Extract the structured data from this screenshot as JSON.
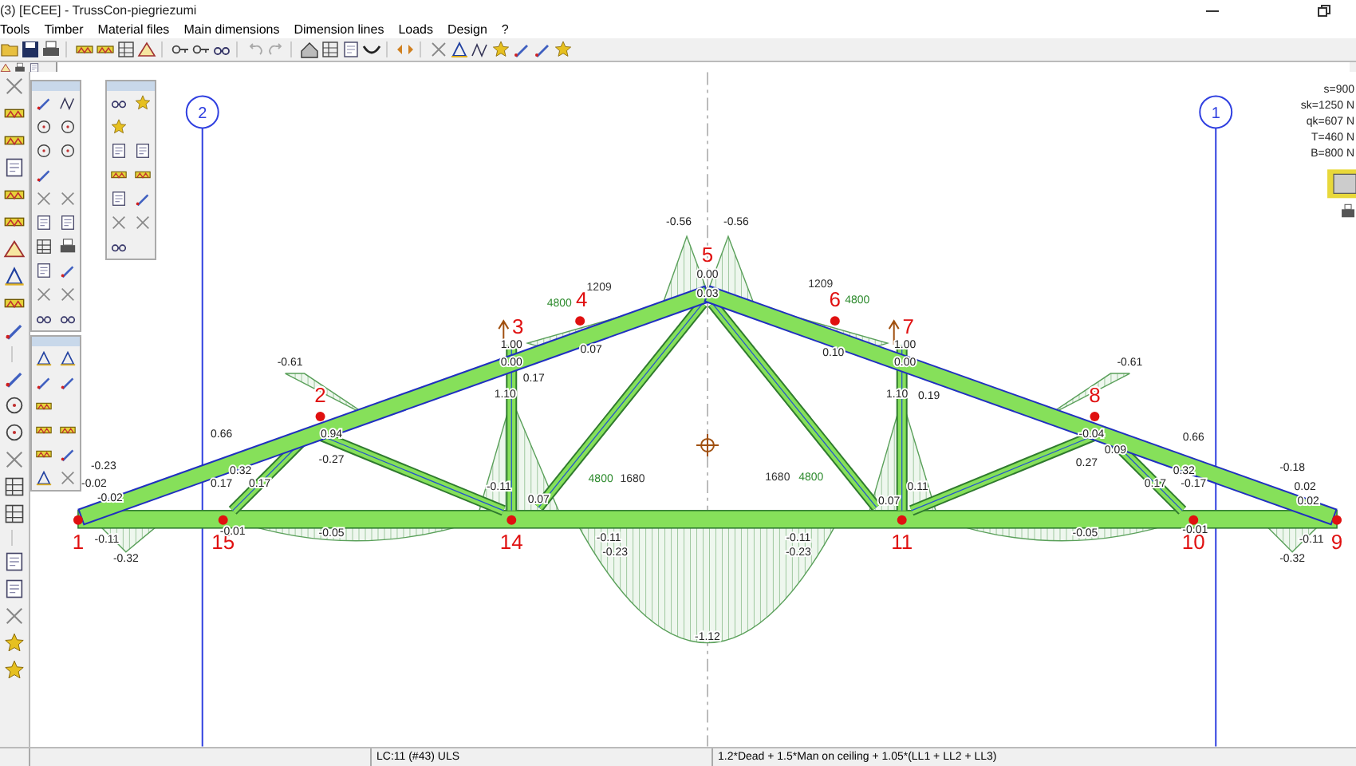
{
  "window": {
    "title": "(3) [ECEE] - TrussCon-piegriezumi"
  },
  "menu": [
    "Tools",
    "Timber",
    "Material files",
    "Main dimensions",
    "Dimension lines",
    "Loads",
    "Design",
    "?"
  ],
  "grid_axes": [
    {
      "label": "2"
    },
    {
      "label": "1"
    }
  ],
  "legend": [
    "s=900",
    "sk=1250 N",
    "qk=607 N",
    "T=460 N",
    "B=800 N"
  ],
  "nodes": [
    {
      "label": "1"
    },
    {
      "label": "15"
    },
    {
      "label": "2"
    },
    {
      "label": "14"
    },
    {
      "label": "3"
    },
    {
      "label": "4"
    },
    {
      "label": "5"
    },
    {
      "label": "6"
    },
    {
      "label": "11"
    },
    {
      "label": "7"
    },
    {
      "label": "8"
    },
    {
      "label": "10"
    },
    {
      "label": "9"
    }
  ],
  "values": [
    {
      "text": "-0.23",
      "kind": "moment"
    },
    {
      "text": "-0.02",
      "kind": "moment"
    },
    {
      "text": "-0.02",
      "kind": "moment"
    },
    {
      "text": "-0.11",
      "kind": "moment"
    },
    {
      "text": "-0.32",
      "kind": "moment"
    },
    {
      "text": "0.66",
      "kind": "moment"
    },
    {
      "text": "0.32",
      "kind": "moment"
    },
    {
      "text": "0.17",
      "kind": "moment"
    },
    {
      "text": "0.17",
      "kind": "moment"
    },
    {
      "text": "-0.01",
      "kind": "moment"
    },
    {
      "text": "-0.05",
      "kind": "moment"
    },
    {
      "text": "-0.61",
      "kind": "moment"
    },
    {
      "text": "0.94",
      "kind": "moment"
    },
    {
      "text": "-0.27",
      "kind": "moment"
    },
    {
      "text": "1.00",
      "kind": "moment"
    },
    {
      "text": "0.00",
      "kind": "moment"
    },
    {
      "text": "0.17",
      "kind": "moment"
    },
    {
      "text": "1.10",
      "kind": "moment"
    },
    {
      "text": "-0.11",
      "kind": "moment"
    },
    {
      "text": "0.07",
      "kind": "moment"
    },
    {
      "text": "0.07",
      "kind": "moment"
    },
    {
      "text": "4800",
      "kind": "dimension"
    },
    {
      "text": "1209",
      "kind": "position"
    },
    {
      "text": "4800",
      "kind": "dimension"
    },
    {
      "text": "1680",
      "kind": "position"
    },
    {
      "text": "-0.11",
      "kind": "moment"
    },
    {
      "text": "-0.23",
      "kind": "moment"
    },
    {
      "text": "-0.56",
      "kind": "moment"
    },
    {
      "text": "-0.56",
      "kind": "moment"
    },
    {
      "text": "0.00",
      "kind": "moment"
    },
    {
      "text": "0.03",
      "kind": "moment"
    },
    {
      "text": "-1.12",
      "kind": "moment"
    },
    {
      "text": "1209",
      "kind": "position"
    },
    {
      "text": "4800",
      "kind": "dimension"
    },
    {
      "text": "0.10",
      "kind": "moment"
    },
    {
      "text": "1.00",
      "kind": "moment"
    },
    {
      "text": "0.00",
      "kind": "moment"
    },
    {
      "text": "1.10",
      "kind": "moment"
    },
    {
      "text": "0.19",
      "kind": "moment"
    },
    {
      "text": "1680",
      "kind": "position"
    },
    {
      "text": "4800",
      "kind": "dimension"
    },
    {
      "text": "0.11",
      "kind": "moment"
    },
    {
      "text": "0.07",
      "kind": "moment"
    },
    {
      "text": "-0.11",
      "kind": "moment"
    },
    {
      "text": "-0.23",
      "kind": "moment"
    },
    {
      "text": "-0.61",
      "kind": "moment"
    },
    {
      "text": "-0.04",
      "kind": "moment"
    },
    {
      "text": "0.09",
      "kind": "moment"
    },
    {
      "text": "0.27",
      "kind": "moment"
    },
    {
      "text": "0.66",
      "kind": "moment"
    },
    {
      "text": "0.32",
      "kind": "moment"
    },
    {
      "text": "0.17",
      "kind": "moment"
    },
    {
      "text": "-0.17",
      "kind": "moment"
    },
    {
      "text": "-0.05",
      "kind": "moment"
    },
    {
      "text": "-0.01",
      "kind": "moment"
    },
    {
      "text": "-0.18",
      "kind": "moment"
    },
    {
      "text": "0.02",
      "kind": "moment"
    },
    {
      "text": "0.02",
      "kind": "moment"
    },
    {
      "text": "-0.11",
      "kind": "moment"
    },
    {
      "text": "-0.32",
      "kind": "moment"
    }
  ],
  "status_bar": {
    "load_case": "LC:11 (#43) ULS",
    "combination": "1.2*Dead + 1.5*Man on ceiling + 1.05*(LL1 + LL2 + LL3)"
  }
}
